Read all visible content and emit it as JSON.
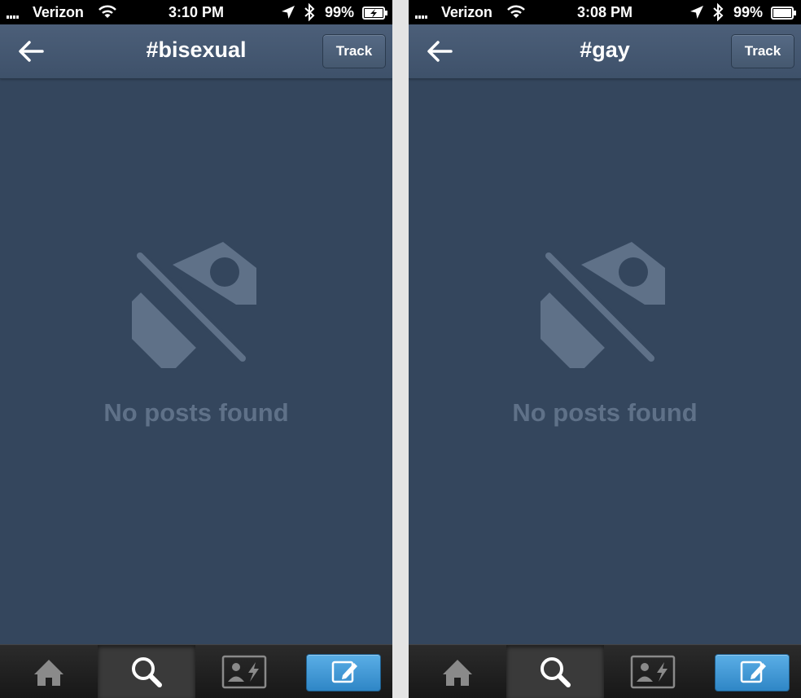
{
  "colors": {
    "background": "#34465d",
    "nav_bar": "#45586f",
    "empty_state": "#5f7188",
    "compose_accent": "#3b96d6"
  },
  "screens": [
    {
      "status_bar": {
        "carrier": "Verizon",
        "time": "3:10 PM",
        "battery": "99%",
        "battery_charging": true
      },
      "nav": {
        "back_icon": "left-arrow-icon",
        "title": "#bisexual",
        "track_label": "Track"
      },
      "empty_state": {
        "icon": "tag-slash-icon",
        "text": "No posts found"
      },
      "tab_bar": {
        "tabs": [
          {
            "icon": "home-icon",
            "active": false
          },
          {
            "icon": "search-icon",
            "active": true
          },
          {
            "icon": "activity-icon",
            "active": false
          },
          {
            "icon": "compose-icon",
            "active": false
          }
        ]
      }
    },
    {
      "status_bar": {
        "carrier": "Verizon",
        "time": "3:08 PM",
        "battery": "99%",
        "battery_charging": false
      },
      "nav": {
        "back_icon": "left-arrow-icon",
        "title": "#gay",
        "track_label": "Track"
      },
      "empty_state": {
        "icon": "tag-slash-icon",
        "text": "No posts found"
      },
      "tab_bar": {
        "tabs": [
          {
            "icon": "home-icon",
            "active": false
          },
          {
            "icon": "search-icon",
            "active": true
          },
          {
            "icon": "activity-icon",
            "active": false
          },
          {
            "icon": "compose-icon",
            "active": false
          }
        ]
      }
    }
  ]
}
